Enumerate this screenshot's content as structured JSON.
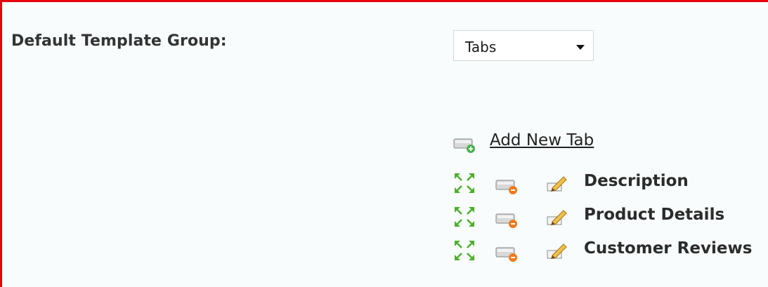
{
  "settings": {
    "default_template_group_label": "Default Template Group:",
    "template_group_select": {
      "selected": "Tabs"
    }
  },
  "tabs_manager": {
    "add_new_tab_label": "Add New Tab",
    "tabs": [
      {
        "label": "Description"
      },
      {
        "label": "Product Details"
      },
      {
        "label": "Customer Reviews"
      }
    ]
  },
  "icons": {
    "move": "move-arrows-icon",
    "delete": "delete-tab-icon",
    "edit": "edit-pencil-icon",
    "add": "add-tab-icon"
  },
  "colors": {
    "border": "#e8000d",
    "background": "#f8fcfc",
    "move_arrows": "#4caf2a",
    "delete_badge": "#f07a1d",
    "add_badge": "#4bb24b"
  }
}
